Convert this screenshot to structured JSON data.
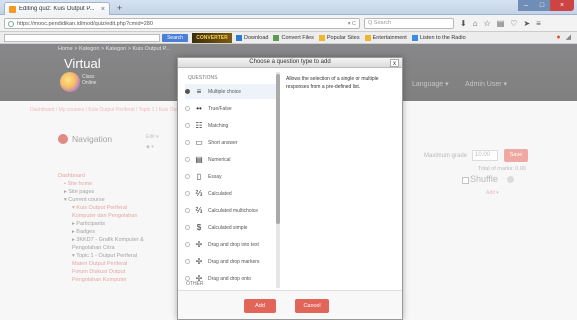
{
  "browser": {
    "tab_title": "Editing quiz: Kuis Output P...",
    "url": "https://mooc.pendidikan.id/mod/quiz/edit.php?cmid=280",
    "search_placeholder": "Q Search",
    "toolbar": {
      "search_label": "Search",
      "logo_text": "CONVERTER",
      "items": [
        "Download",
        "Convert Files",
        "Popular Sites",
        "Entertainment",
        "Listen to the Radio"
      ]
    }
  },
  "site": {
    "breadcrumb": "Home > Kategori > Kategori > Kuis Output P...",
    "logo_title": "Virtual",
    "logo_sub_1": "Class",
    "logo_sub_2": "Online",
    "menu_language": "Language",
    "menu_user": "Admin User",
    "course_strip": "Dashboard / My courses / Kuis Output Periferal / Topic 1 / Kuis Output Periferal / Editing quiz"
  },
  "navigation": {
    "title": "Navigation",
    "tools_1": "Edit ▾",
    "tools_2": "◆ ▾",
    "items": [
      {
        "text": "Dashboard",
        "cls": "pink"
      },
      {
        "text": "• Site home",
        "cls": "pink ind1"
      },
      {
        "text": "▸ Site pages",
        "cls": "ind1"
      },
      {
        "text": "▾ Current course",
        "cls": "ind1"
      },
      {
        "text": "▾ Kuis Output Periferal",
        "cls": "pink ind2"
      },
      {
        "text": "  Komputer dan Pengolahan",
        "cls": "pink ind2"
      },
      {
        "text": "▸ Participants",
        "cls": "ind2"
      },
      {
        "text": "▸ Badges",
        "cls": "ind2"
      },
      {
        "text": "▸ 3KKD7 - Grafik Komputer &",
        "cls": "ind2"
      },
      {
        "text": "  Pengolahan Citra",
        "cls": "ind2"
      },
      {
        "text": "▾ Topic 1 - Output Periferal",
        "cls": "ind2"
      },
      {
        "text": "  Materi Output Periferal",
        "cls": "pink ind2"
      },
      {
        "text": "  Forum Diskusi Output",
        "cls": "pink ind2"
      },
      {
        "text": "  Pengolahan Komputer",
        "cls": "pink ind2"
      }
    ]
  },
  "quiz": {
    "max_grade_label": "Maximum grade",
    "max_grade_value": "10.00",
    "save_label": "Save",
    "total_marks": "Total of marks: 0.00",
    "shuffle_label": "Shuffle",
    "add_label": "Add ▾"
  },
  "dialog": {
    "title": "Choose a question type to add",
    "close_symbol": "x",
    "category_label": "QUESTIONS",
    "other_label": "OTHER",
    "options": [
      {
        "label": "Multiple choice",
        "icon": "≡",
        "selected": true
      },
      {
        "label": "True/False",
        "icon": "••",
        "selected": false
      },
      {
        "label": "Matching",
        "icon": "☷",
        "selected": false
      },
      {
        "label": "Short answer",
        "icon": "▭",
        "selected": false
      },
      {
        "label": "Numerical",
        "icon": "▤",
        "selected": false
      },
      {
        "label": "Essay",
        "icon": "▯",
        "selected": false
      },
      {
        "label": "Calculated",
        "icon": "⅔",
        "selected": false
      },
      {
        "label": "Calculated multichoice",
        "icon": "⅔",
        "selected": false
      },
      {
        "label": "Calculated simple",
        "icon": "$",
        "selected": false
      },
      {
        "label": "Drag and drop into text",
        "icon": "✢",
        "selected": false
      },
      {
        "label": "Drag and drop markers",
        "icon": "✢",
        "selected": false
      },
      {
        "label": "Drag and drop onto",
        "icon": "✢",
        "selected": false
      }
    ],
    "description": "Allows the selection of a single or multiple responses from a pre-defined list.",
    "add_button": "Add",
    "cancel_button": "Cancel"
  }
}
